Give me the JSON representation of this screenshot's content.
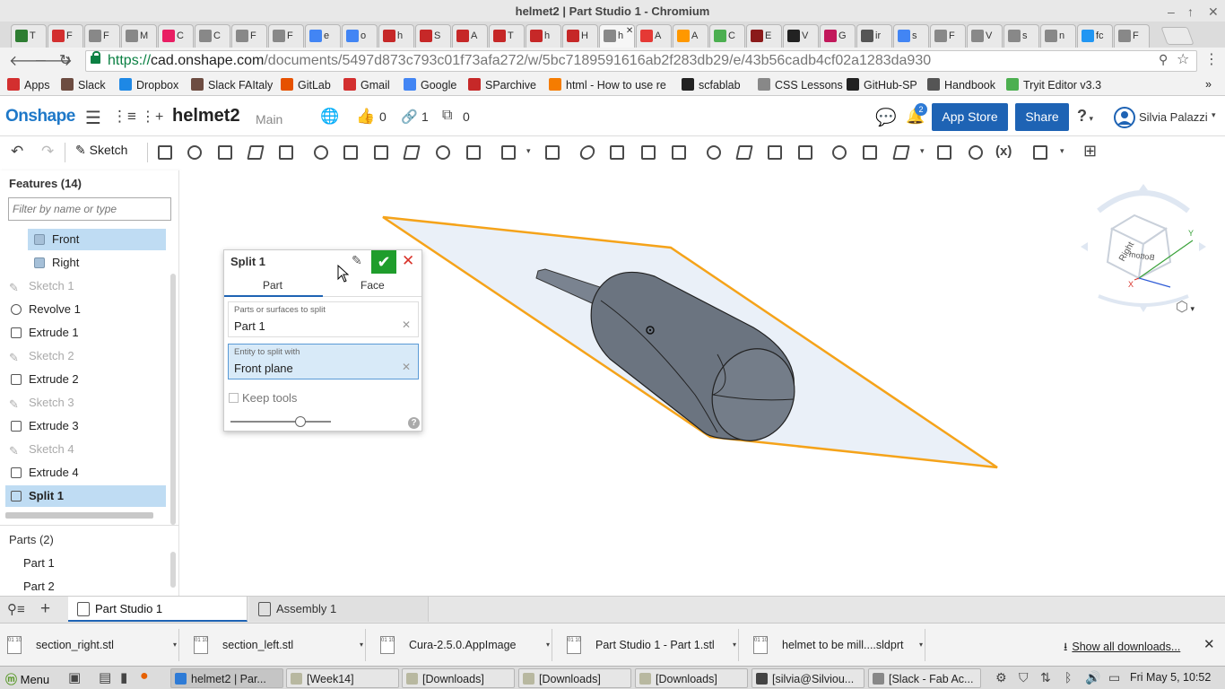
{
  "window": {
    "title": "helmet2 | Part Studio 1 - Chromium"
  },
  "browser_tabs": [
    {
      "label": "T",
      "color": "#2e7d32"
    },
    {
      "label": "F",
      "color": "#d32f2f"
    },
    {
      "label": "F",
      "color": "#888888"
    },
    {
      "label": "M",
      "color": "#888888"
    },
    {
      "label": "C",
      "color": "#e91e63"
    },
    {
      "label": "C",
      "color": "#888888"
    },
    {
      "label": "F",
      "color": "#888888"
    },
    {
      "label": "F",
      "color": "#888888"
    },
    {
      "label": "e",
      "color": "#4285f4"
    },
    {
      "label": "o",
      "color": "#4285f4"
    },
    {
      "label": "h",
      "color": "#c62828"
    },
    {
      "label": "S",
      "color": "#c62828"
    },
    {
      "label": "A",
      "color": "#c62828"
    },
    {
      "label": "T",
      "color": "#c62828"
    },
    {
      "label": "h",
      "color": "#c62828"
    },
    {
      "label": "H",
      "color": "#c62828"
    },
    {
      "label": "h",
      "color": "#888888"
    },
    {
      "label": "A",
      "color": "#e53935"
    },
    {
      "label": "A",
      "color": "#ff9800"
    },
    {
      "label": "C",
      "color": "#4caf50"
    },
    {
      "label": "E",
      "color": "#8b1a1a"
    },
    {
      "label": "V",
      "color": "#222222"
    },
    {
      "label": "G",
      "color": "#c2185b"
    },
    {
      "label": "ir",
      "color": "#555555"
    },
    {
      "label": "s",
      "color": "#4285f4"
    },
    {
      "label": "F",
      "color": "#888888"
    },
    {
      "label": "V",
      "color": "#888888"
    },
    {
      "label": "s",
      "color": "#888888"
    },
    {
      "label": "n",
      "color": "#888888"
    },
    {
      "label": "fc",
      "color": "#2196f3"
    },
    {
      "label": "F",
      "color": "#888888"
    }
  ],
  "address": {
    "scheme": "https://",
    "host": "cad.onshape.com",
    "path": "/documents/5497d873c793c01f73afa272/w/5bc7189591616ab2f283db29/e/43b56cadb4cf02a1283da930"
  },
  "bookmarks": [
    {
      "label": "Apps",
      "color": "#d32f2f"
    },
    {
      "label": "Slack",
      "color": "#6d4c41"
    },
    {
      "label": "Dropbox",
      "color": "#1e88e5"
    },
    {
      "label": "Slack FAItaly",
      "color": "#6d4c41"
    },
    {
      "label": "GitLab",
      "color": "#e65100"
    },
    {
      "label": "Gmail",
      "color": "#d32f2f"
    },
    {
      "label": "Google",
      "color": "#4285f4"
    },
    {
      "label": "SParchive",
      "color": "#c62828"
    },
    {
      "label": "html - How to use re",
      "color": "#f57c00"
    },
    {
      "label": "scfablab",
      "color": "#222222"
    },
    {
      "label": "CSS Lessons",
      "color": "#888888"
    },
    {
      "label": "GitHub-SP",
      "color": "#222222"
    },
    {
      "label": "Handbook",
      "color": "#555555"
    },
    {
      "label": "Tryit Editor v3.3",
      "color": "#4caf50"
    }
  ],
  "onshape": {
    "logo": "Onshape",
    "doc_name": "helmet2",
    "branch": "Main",
    "likes": "0",
    "links": "1",
    "copies": "0",
    "notifications": "2",
    "app_store": "App Store",
    "share": "Share",
    "help": "?",
    "user": "Silvia Palazzi"
  },
  "toolbar": {
    "sketch_label": "Sketch",
    "variable_label": "(x)"
  },
  "features": {
    "title": "Features (14)",
    "filter_placeholder": "Filter by name or type",
    "items": [
      {
        "label": "Front"
      },
      {
        "label": "Right"
      },
      {
        "label": "Sketch 1"
      },
      {
        "label": "Revolve 1"
      },
      {
        "label": "Extrude 1"
      },
      {
        "label": "Sketch 2"
      },
      {
        "label": "Extrude 2"
      },
      {
        "label": "Sketch 3"
      },
      {
        "label": "Extrude 3"
      },
      {
        "label": "Sketch 4"
      },
      {
        "label": "Extrude 4"
      },
      {
        "label": "Split 1"
      }
    ]
  },
  "parts": {
    "title": "Parts (2)",
    "items": [
      "Part 1",
      "Part 2"
    ]
  },
  "split_dialog": {
    "title": "Split 1",
    "tab_part": "Part",
    "tab_face": "Face",
    "field1_label": "Parts or surfaces to split",
    "field1_value": "Part 1",
    "field2_label": "Entity to split with",
    "field2_value": "Front plane",
    "keep_tools": "Keep tools"
  },
  "viewcube": {
    "face_right": "Right",
    "face_bottom": "Bottom",
    "axis_x": "X",
    "axis_y": "Y"
  },
  "bottom_tabs": [
    "Part Studio 1",
    "Assembly 1"
  ],
  "downloads": {
    "items": [
      "section_right.stl",
      "section_left.stl",
      "Cura-2.5.0.AppImage",
      "Part Studio 1 - Part 1.stl",
      "helmet to be mill....sldprt"
    ],
    "show_all": "Show all downloads..."
  },
  "taskbar": {
    "menu": "Menu",
    "items": [
      "helmet2 | Par...",
      "[Week14]",
      "[Downloads]",
      "[Downloads]",
      "[Downloads]",
      "[silvia@Silviou...",
      "[Slack - Fab Ac..."
    ],
    "clock": "Fri May 5, 10:52"
  },
  "colors": {
    "onshape_blue": "#1e63b4",
    "selection": "#bfdcf3",
    "plane_outline": "#f5a31a",
    "part": "#6b7480"
  }
}
